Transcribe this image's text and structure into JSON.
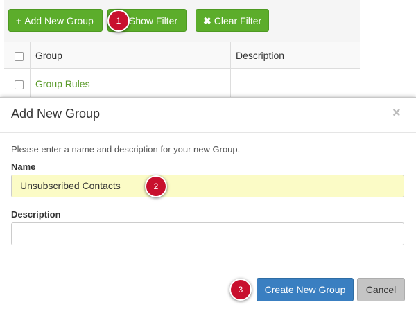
{
  "toolbar": {
    "add_label": "Add New Group",
    "add_icon": "plus-icon",
    "show_filter_label": "Show Filter",
    "clear_filter_label": "Clear Filter",
    "clear_icon": "x-icon"
  },
  "table": {
    "columns": [
      "Group",
      "Description"
    ],
    "rows": [
      {
        "group": "Group Rules",
        "description": ""
      }
    ]
  },
  "modal": {
    "title": "Add New Group",
    "close_symbol": "×",
    "intro": "Please enter a name and description for your new Group.",
    "name_label": "Name",
    "name_value": "Unsubscribed Contacts",
    "description_label": "Description",
    "description_value": "",
    "create_label": "Create New Group",
    "cancel_label": "Cancel"
  },
  "steps": [
    "1",
    "2",
    "3"
  ],
  "colors": {
    "green_button": "#5cad2b",
    "blue_button": "#3a7fc1",
    "callout": "#c8102e",
    "name_field_highlight": "#fbfbc6"
  }
}
